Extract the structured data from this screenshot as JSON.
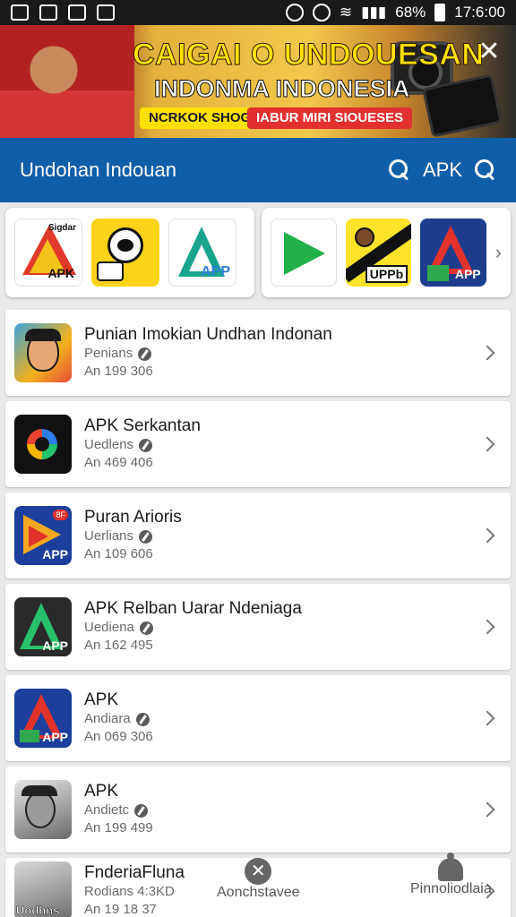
{
  "status_bar": {
    "battery": "68%",
    "time": "17:6:00"
  },
  "banner": {
    "title": "CAIGAI O UNDOUESAN",
    "subtitle": "INDONMA INDONESIA",
    "tag1": "NCRKOK SHOGY",
    "tag2": "IABUR MIRI SIOUESES"
  },
  "app_bar": {
    "title": "Undohan Indouan",
    "apk_label": "APK"
  },
  "featured": {
    "left": [
      {
        "icon": "apk-icon",
        "label": "APK",
        "small": "Sigdar"
      },
      {
        "icon": "yellow-cartoon-icon"
      },
      {
        "icon": "app-green-icon",
        "label": "APP"
      }
    ],
    "right": [
      {
        "icon": "play-icon"
      },
      {
        "icon": "uppb-icon",
        "label": "UPPb"
      },
      {
        "icon": "app-red-icon",
        "label": "APP"
      }
    ]
  },
  "list": [
    {
      "title": "Punian Imokian Undhan Indonan",
      "subtitle": "Penians",
      "meta": "An 199 306",
      "icon": "face-icon"
    },
    {
      "title": "APK Serkantan",
      "subtitle": "Uedlens",
      "meta": "An 469 406",
      "icon": "google-d-icon"
    },
    {
      "title": "Puran Arioris",
      "subtitle": "Uerlians",
      "meta": "An 109 606",
      "icon": "play-app-icon",
      "icon_label": "APP",
      "icon_tag": "8F"
    },
    {
      "title": "APK Relban Uarar Ndeniaga",
      "subtitle": "Uediena",
      "meta": "An 162 495",
      "icon": "green-a-icon",
      "icon_label": "APP"
    },
    {
      "title": "APK",
      "subtitle": "Andiara",
      "meta": "An 069 306",
      "icon": "red-a-icon",
      "icon_label": "APP"
    },
    {
      "title": "APK",
      "subtitle": "Andietc",
      "meta": "An 199 499",
      "icon": "photo-face-icon"
    },
    {
      "title": "FnderiaFluna",
      "subtitle": "Rodians 4:3KD",
      "meta": "An 19 18 37",
      "icon": "photo-icon",
      "icon_label": "Uodhns"
    }
  ],
  "bottom_nav": {
    "center_label": "Aonchstavee",
    "right_label": "Pinnoliodlaia"
  },
  "colors": {
    "appbar": "#0f5ea8",
    "background": "#e9e9ea"
  }
}
